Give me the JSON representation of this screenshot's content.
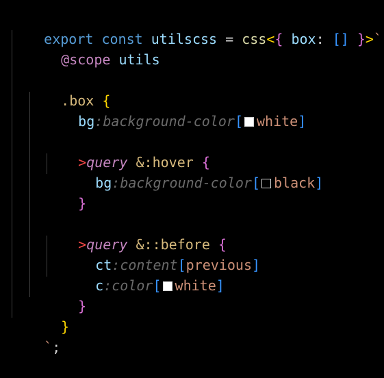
{
  "code": {
    "l1": {
      "export": "export",
      "const": "const",
      "name": "utilscss",
      "eq": "=",
      "tag": "css",
      "lt": "<",
      "obrace": "{",
      "key": "box",
      "colon": ":",
      "arr": "[]",
      "cbrace": "}",
      "gt": ">",
      "tick": "`"
    },
    "l2": {
      "at": "@scope",
      "name": "utils"
    },
    "l4": {
      "sel": ".box",
      "brace": "{"
    },
    "l5": {
      "prop": "bg",
      "colon": ":",
      "long": "background-color",
      "ob": "[",
      "val": "white",
      "cb": "]",
      "swatch_color": "#ffffff"
    },
    "l7": {
      "gt": ">",
      "kw": "query",
      "sel": "&:hover",
      "brace": "{"
    },
    "l8": {
      "prop": "bg",
      "colon": ":",
      "long": "background-color",
      "ob": "[",
      "val": "black",
      "cb": "]",
      "swatch_color": "#000000"
    },
    "l9": {
      "brace": "}"
    },
    "l11": {
      "gt": ">",
      "kw": "query",
      "sel": "&::before",
      "brace": "{"
    },
    "l12": {
      "prop": "ct",
      "colon": ":",
      "long": "content",
      "ob": "[",
      "val": "previous",
      "cb": "]"
    },
    "l13": {
      "prop": "c",
      "colon": ":",
      "long": "color",
      "ob": "[",
      "val": "white",
      "cb": "]",
      "swatch_color": "#ffffff"
    },
    "l14": {
      "brace": "}"
    },
    "l15": {
      "brace": "}"
    },
    "l16": {
      "tick": "`",
      "semi": ";"
    }
  }
}
